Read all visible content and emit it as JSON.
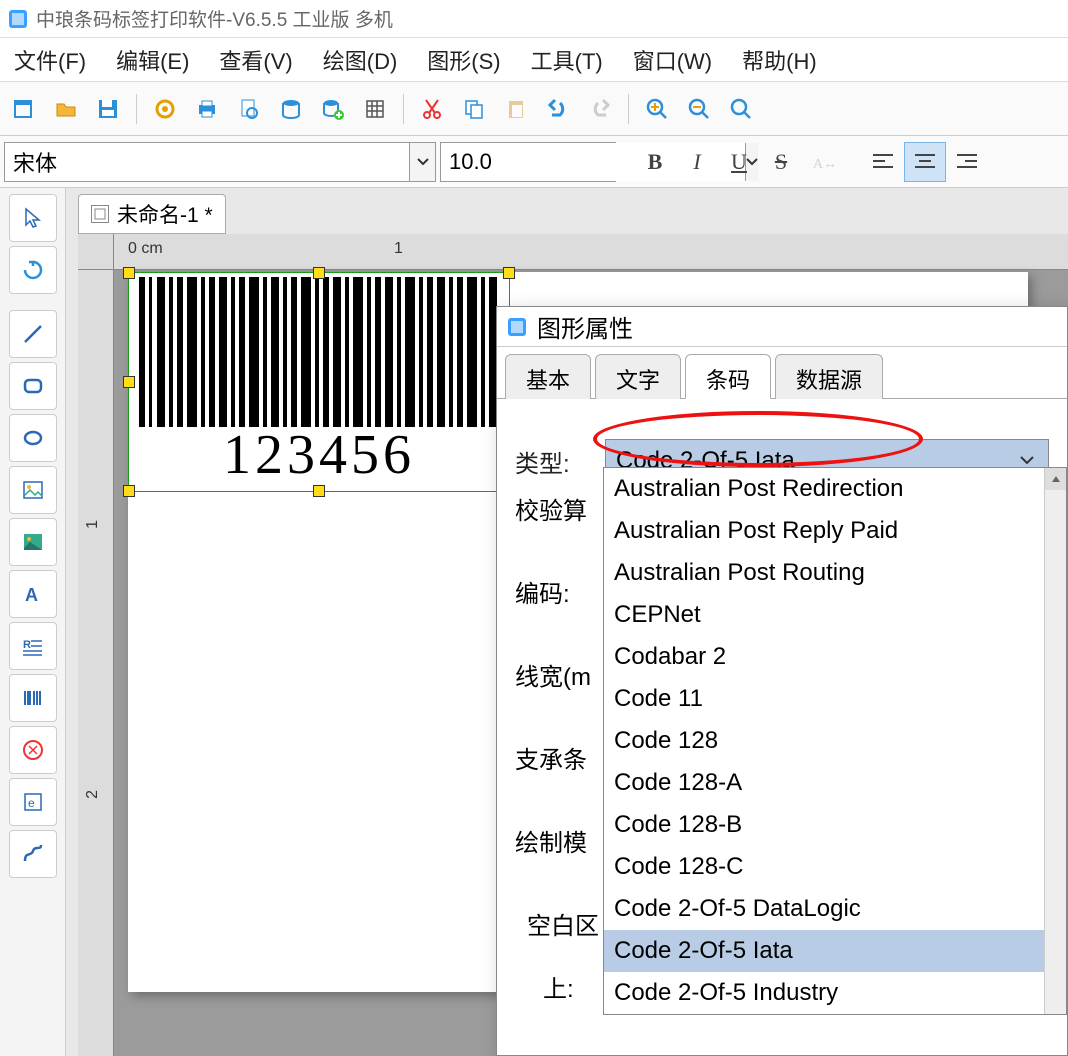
{
  "app": {
    "title": "中琅条码标签打印软件-V6.5.5 工业版 多机"
  },
  "menu": {
    "file": "文件(F)",
    "edit": "编辑(E)",
    "view": "查看(V)",
    "draw": "绘图(D)",
    "shape": "图形(S)",
    "tool": "工具(T)",
    "window": "窗口(W)",
    "help": "帮助(H)"
  },
  "format": {
    "font": "宋体",
    "size": "10.0",
    "bold": "B",
    "italic": "I",
    "underline": "U",
    "strike": "S"
  },
  "doc": {
    "tab_label": "未命名-1 *",
    "barcode_text": "123456"
  },
  "ruler": {
    "unit": "cm",
    "h0": "0",
    "h1": "1",
    "v1": "1",
    "v2": "2"
  },
  "dialog": {
    "title": "图形属性",
    "tabs": {
      "basic": "基本",
      "text": "文字",
      "barcode": "条码",
      "datasource": "数据源"
    },
    "labels": {
      "type": "类型:",
      "checksum": "校验算",
      "encoding": "编码:",
      "linewidth": "线宽(m",
      "bearer": "支承条",
      "drawmode": "绘制模",
      "blank": "空白区",
      "top": "上:"
    },
    "type_value": "Code 2-Of-5 Iata",
    "options": [
      "Australian Post Redirection",
      "Australian Post Reply Paid",
      "Australian Post Routing",
      "CEPNet",
      "Codabar 2",
      "Code 11",
      "Code 128",
      "Code 128-A",
      "Code 128-B",
      "Code 128-C",
      "Code 2-Of-5 DataLogic",
      "Code 2-Of-5 Iata",
      "Code 2-Of-5 Industry"
    ],
    "selected_index": 11
  }
}
